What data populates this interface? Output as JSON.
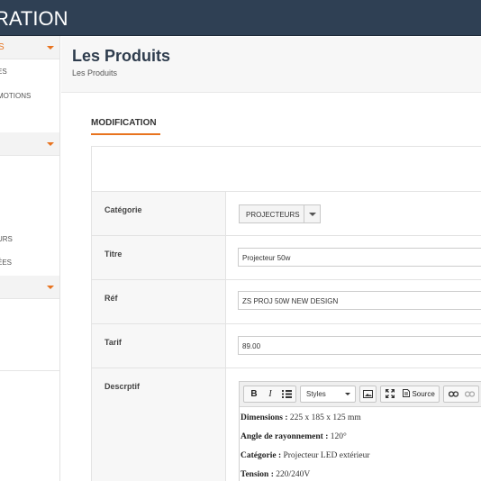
{
  "header": {
    "title": "RATION"
  },
  "sidebar": {
    "section1": {
      "label": "S"
    },
    "items1": [
      "ES",
      "MOTIONS"
    ],
    "items2": [
      "URS",
      "ÉES"
    ]
  },
  "page": {
    "title": "Les Produits",
    "breadcrumb": "Les Produits"
  },
  "tab": {
    "label": "MODIFICATION"
  },
  "form": {
    "categorie": {
      "label": "Catégorie",
      "value": "PROJECTEURS"
    },
    "titre": {
      "label": "Titre",
      "value": "Projecteur 50w"
    },
    "ref": {
      "label": "Réf",
      "value": "ZS PROJ 50W NEW DESIGN"
    },
    "tarif": {
      "label": "Tarif",
      "value": "89.00"
    },
    "descriptif": {
      "label": "Descrptif",
      "toolbar": {
        "bold": "B",
        "italic": "I",
        "styles": "Styles",
        "source": "Source"
      },
      "lines": [
        {
          "key": "Dimensions :",
          "val": "225 x 185 x 125 mm"
        },
        {
          "key": "Angle de rayonnement :",
          "val": "120°"
        },
        {
          "key": "Catégorie :",
          "val": "Projecteur LED extérieur"
        },
        {
          "key": "Tension :",
          "val": "220/240V"
        }
      ]
    }
  },
  "colors": {
    "header_bg": "#2f4054",
    "accent": "#e8731e"
  }
}
